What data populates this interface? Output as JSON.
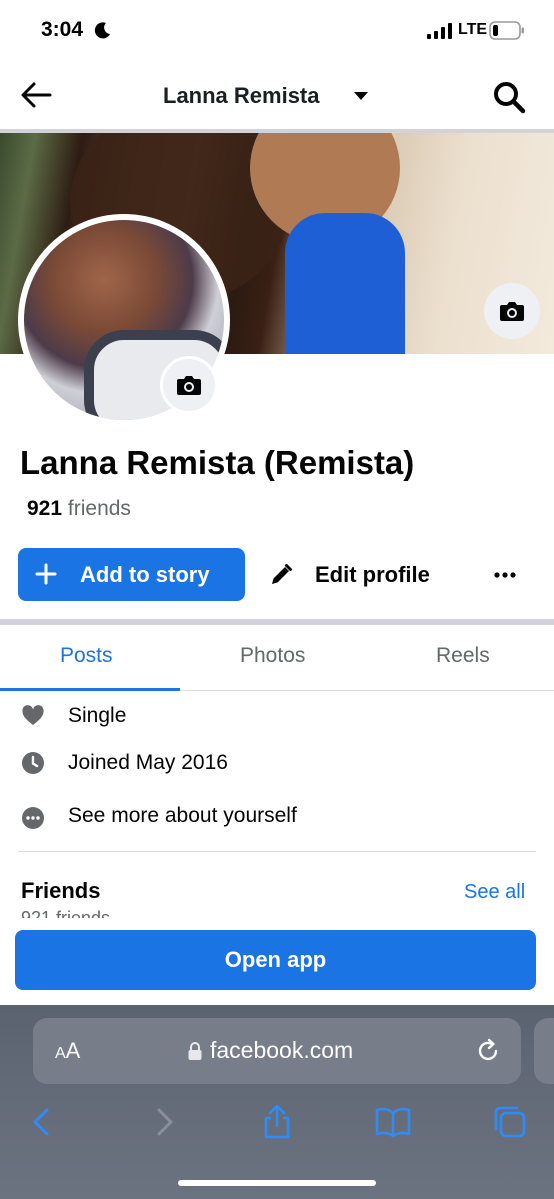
{
  "status_bar": {
    "time": "3:04",
    "network": "LTE"
  },
  "header": {
    "title": "Lanna Remista"
  },
  "profile": {
    "name": "Lanna Remista (Remista)",
    "friends_count": "921",
    "friends_label": "friends"
  },
  "actions": {
    "add_story": "Add to story",
    "edit_profile": "Edit profile"
  },
  "tabs": [
    {
      "label": "Posts",
      "active": true
    },
    {
      "label": "Photos",
      "active": false
    },
    {
      "label": "Reels",
      "active": false
    }
  ],
  "intro": [
    {
      "icon": "heart-icon",
      "text": "Single"
    },
    {
      "icon": "clock-icon",
      "text": "Joined May 2016"
    },
    {
      "icon": "more-circle-icon",
      "text": "See more about yourself"
    }
  ],
  "friends_section": {
    "heading": "Friends",
    "see_all": "See all",
    "subtitle": "921 friends"
  },
  "open_app": "Open app",
  "browser": {
    "aa_small": "A",
    "aa_big": "A",
    "url": "facebook.com"
  },
  "colors": {
    "accent": "#1b74e4",
    "text": "#050505",
    "muted": "#65676b"
  }
}
